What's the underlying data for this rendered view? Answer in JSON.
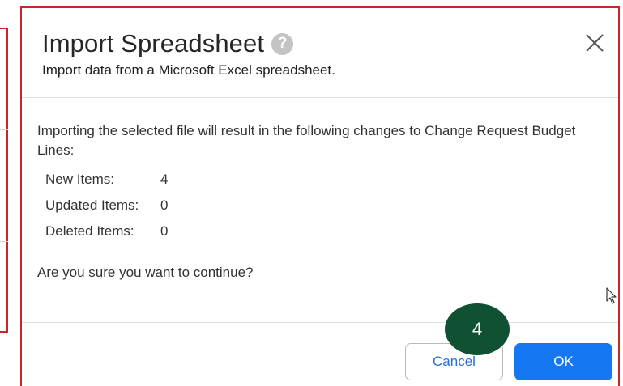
{
  "dialog": {
    "title": "Import Spreadsheet",
    "help_icon": "question-mark-icon",
    "subtitle": "Import data from a Microsoft Excel spreadsheet.",
    "close_icon": "close-icon",
    "intro_line1": "Importing the selected file will result in the following changes to Change Request Budget",
    "intro_line2": "Lines:",
    "changes": [
      {
        "label": "New Items:",
        "value": "4"
      },
      {
        "label": "Updated Items:",
        "value": "0"
      },
      {
        "label": "Deleted Items:",
        "value": "0"
      }
    ],
    "confirm_text": "Are you sure you want to continue?",
    "cancel_label": "Cancel",
    "ok_label": "OK"
  },
  "step_badge": {
    "number": "4",
    "color": "#0f5132"
  },
  "colors": {
    "primary": "#1677f2",
    "border_highlight": "#c62828",
    "link_text": "#2a6fd8"
  }
}
